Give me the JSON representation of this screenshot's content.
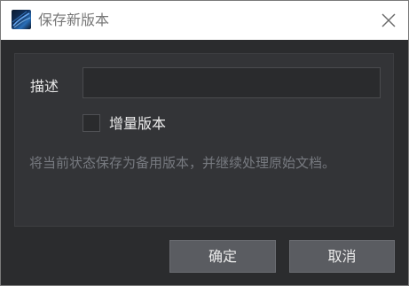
{
  "window": {
    "title": "保存新版本",
    "app_icon": "app-logo-icon",
    "close_icon": "close-icon"
  },
  "form": {
    "description_label": "描述",
    "description_value": "",
    "incremental_checked": false,
    "incremental_label": "增量版本",
    "hint": "将当前状态保存为备用版本，并继续处理原始文档。"
  },
  "buttons": {
    "ok_label": "确定",
    "cancel_label": "取消"
  },
  "colors": {
    "panel_bg": "#333437",
    "dialog_bg": "#2b2c2e",
    "button_bg": "#5a5c61",
    "hint_text": "#777a80"
  }
}
